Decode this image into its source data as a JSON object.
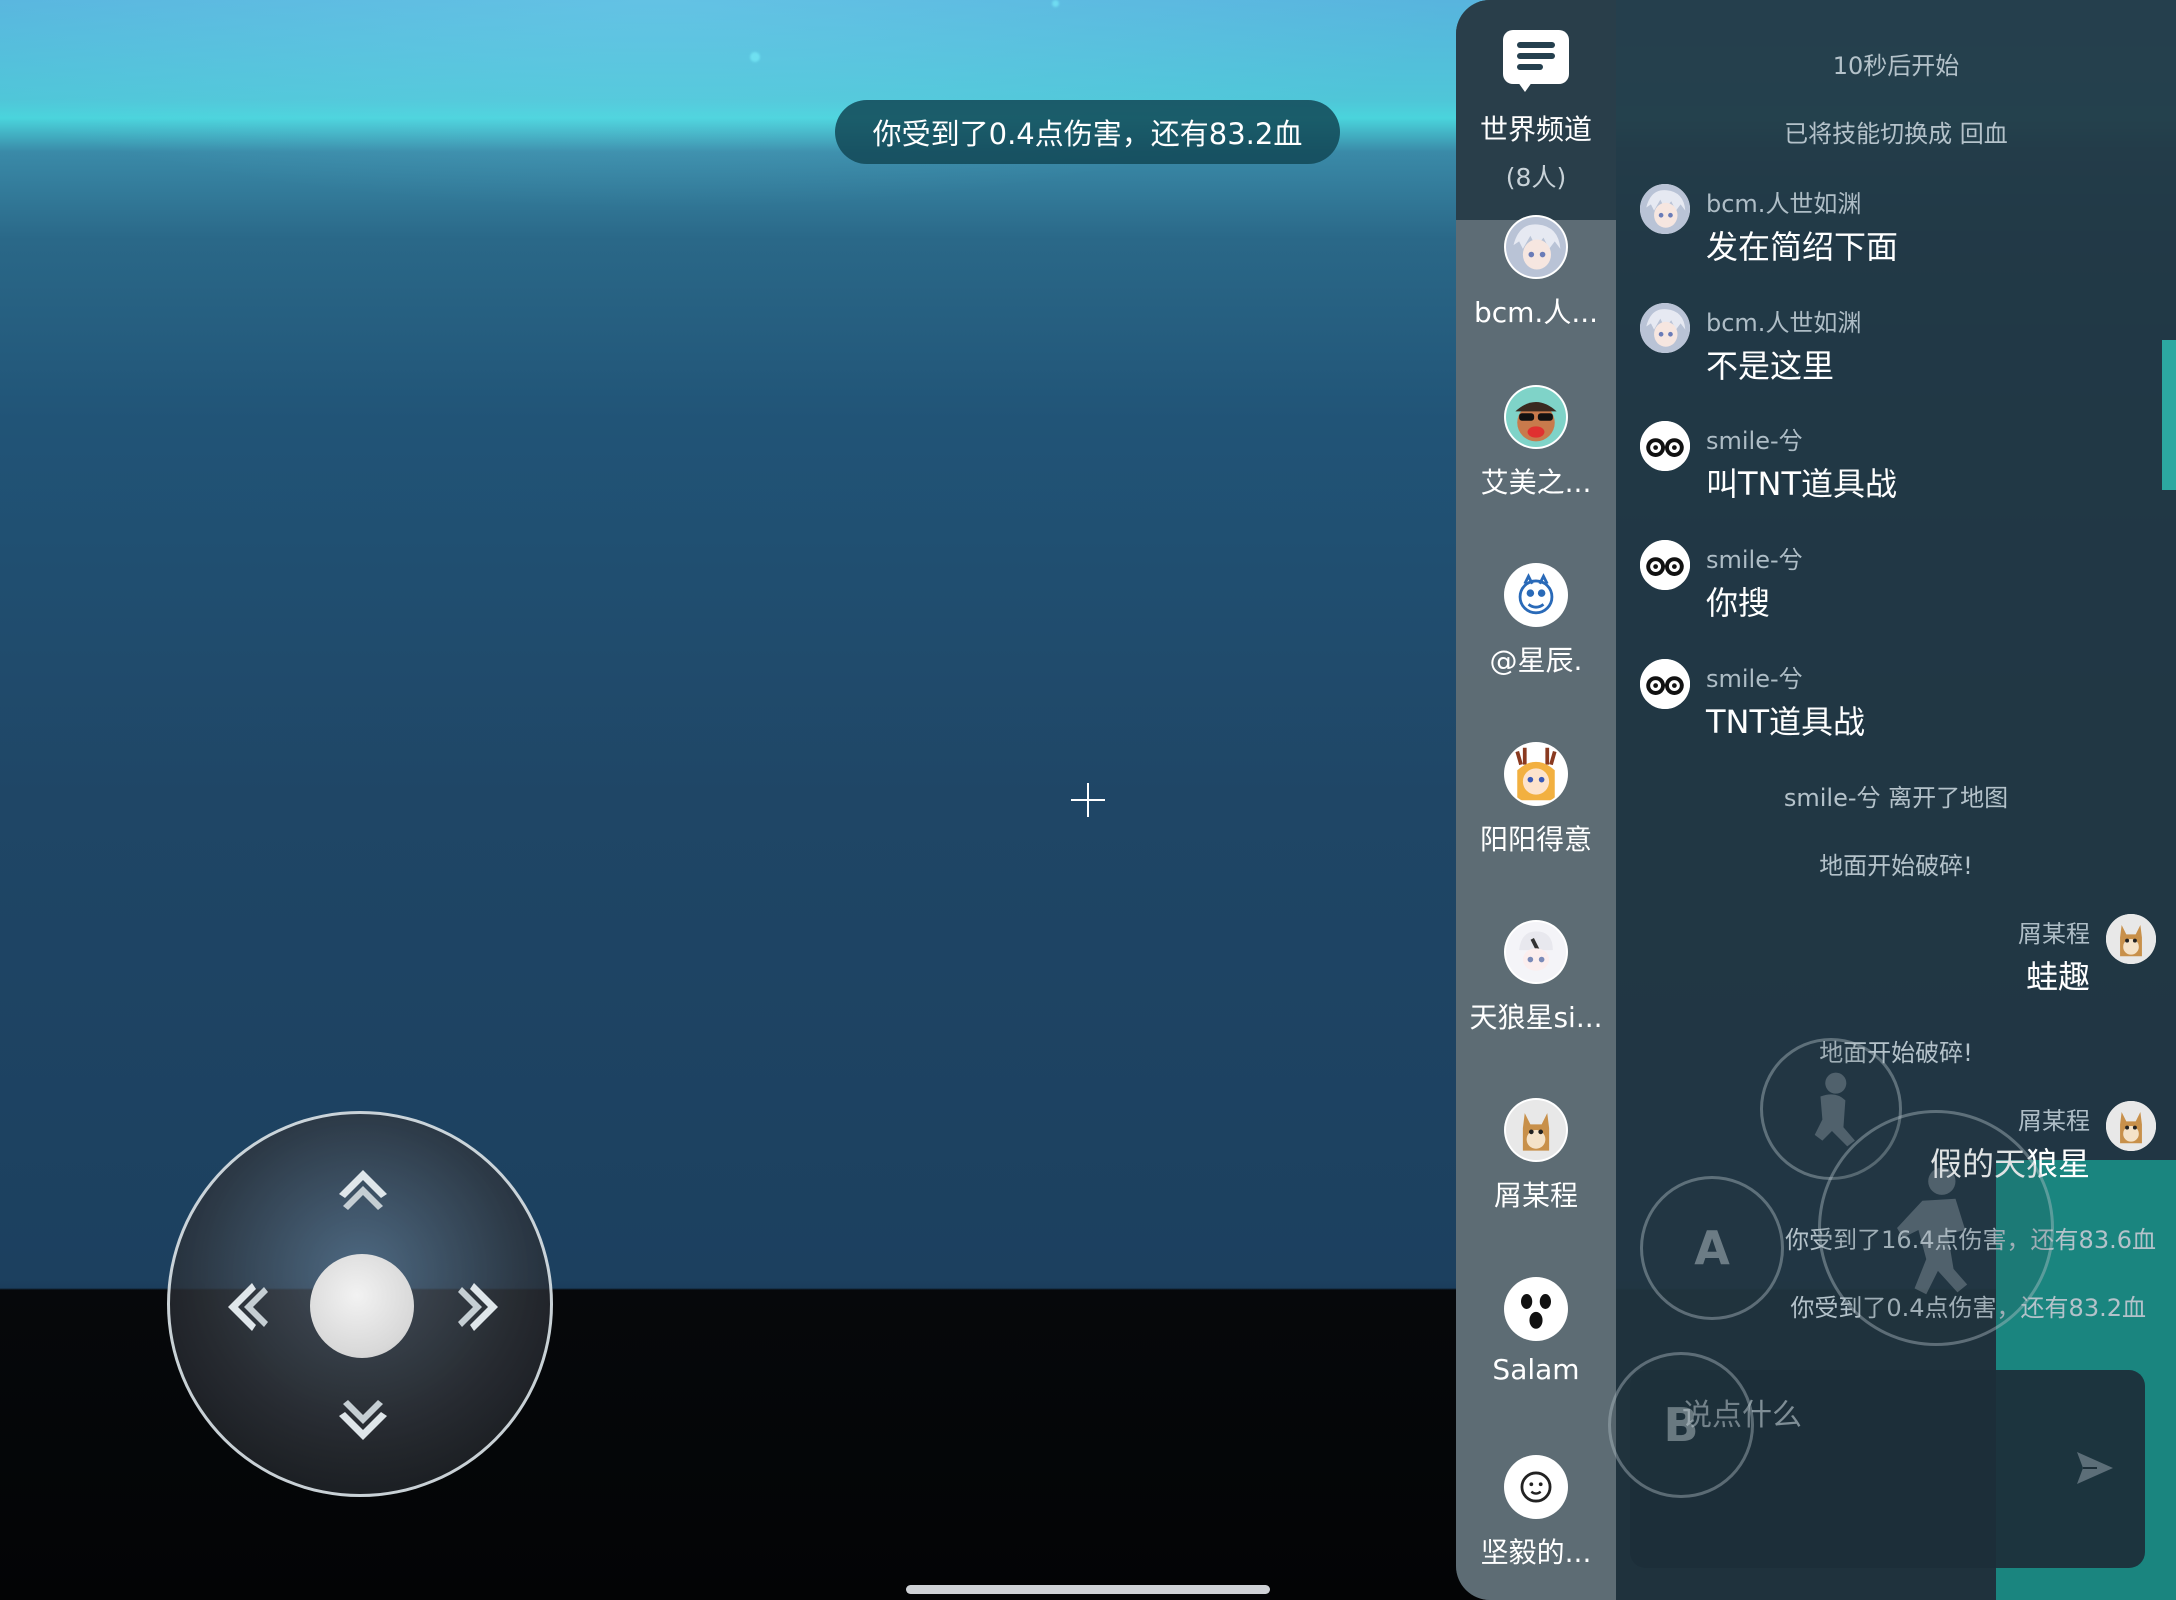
{
  "hud": {
    "damage_toast": "你受到了0.4点伤害，还有83.2血"
  },
  "channel": {
    "title": "世界频道",
    "count": "(8人)",
    "icon": "chat-bubble-icon"
  },
  "members": [
    {
      "name": "bcm.人...",
      "avatar": "anime-boy-avatar"
    },
    {
      "name": "艾美之...",
      "avatar": "sunglasses-kid-avatar"
    },
    {
      "name": "@星辰.",
      "avatar": "cartoon-cat-avatar"
    },
    {
      "name": "阳阳得意",
      "avatar": "reindeer-girl-avatar"
    },
    {
      "name": "天狼星si...",
      "avatar": "chibi-avatar"
    },
    {
      "name": "屑某程",
      "avatar": "shiba-dog-avatar"
    },
    {
      "name": "Salam",
      "avatar": "ghost-face-avatar"
    },
    {
      "name": "坚毅的...",
      "avatar": "smile-face-avatar"
    }
  ],
  "messages": {
    "sys1": "10秒后开始",
    "sys2": "已将技能切换成 回血",
    "m1": {
      "sender": "bcm.人世如渊",
      "text": "发在简绍下面"
    },
    "m2": {
      "sender": "bcm.人世如渊",
      "text": "不是这里"
    },
    "m3": {
      "sender": "smile-兮",
      "text": "叫TNT道具战"
    },
    "m4": {
      "sender": "smile-兮",
      "text": "你搜"
    },
    "m5": {
      "sender": "smile-兮",
      "text": "TNT道具战"
    },
    "sys3": "smile-兮 离开了地图",
    "sys4": "地面开始破碎!",
    "m6": {
      "sender": "屑某程",
      "text": "蛙趣"
    },
    "sys5": "地面开始破碎!",
    "m7": {
      "sender": "屑某程",
      "text": "假的天狼星"
    },
    "sys6": "你受到了16.4点伤害，还有83.6血",
    "sys7": "你受到了0.4点伤害，还有83.2血"
  },
  "input": {
    "placeholder": "说点什么",
    "send_icon": "send-arrow-icon"
  },
  "controls": {
    "button_a": "A",
    "button_b": "B"
  },
  "colors": {
    "panel_bg": "#213642",
    "sky_top": "#58b4de",
    "ocean": "#1f4666",
    "accent_teal": "#1a8e86"
  }
}
